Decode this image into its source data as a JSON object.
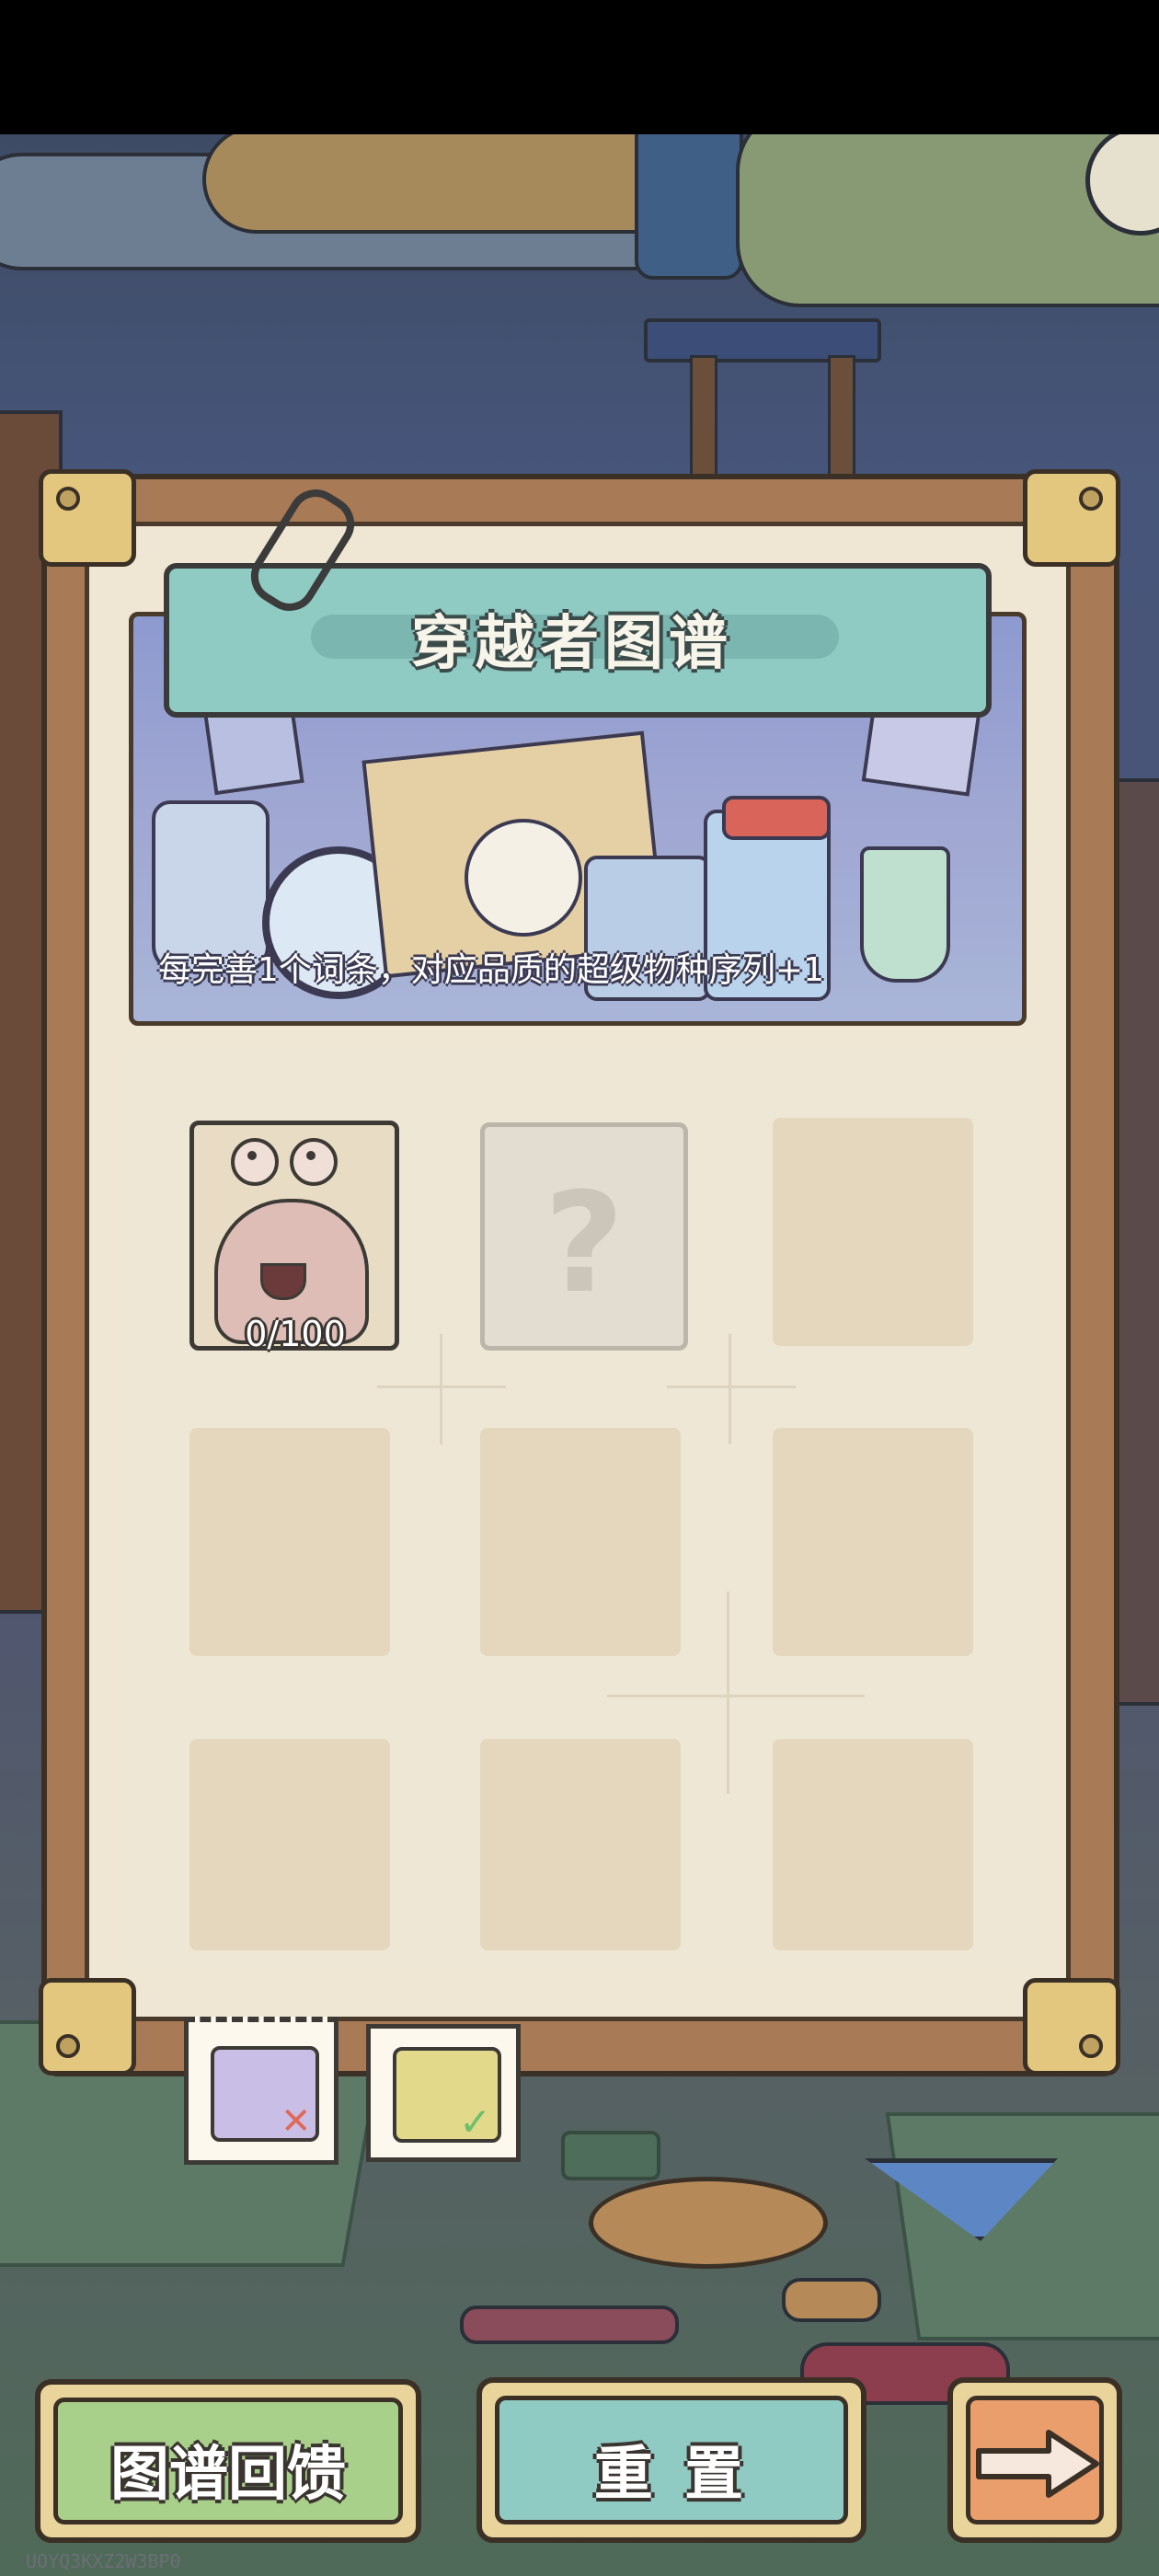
{
  "screen": {
    "title": "穿越者图谱"
  },
  "banner": {
    "description": "每完善1个词条，对应品质的超级物种序列+1"
  },
  "grid": {
    "cards": [
      {
        "state": "unlocked",
        "icon": "snail-creature-icon",
        "progress": "0/100"
      },
      {
        "state": "unknown",
        "icon": "question-mark-icon"
      }
    ],
    "empty_slots": 7
  },
  "filter_tabs": [
    {
      "icon": "card-incomplete-icon",
      "selected": true
    },
    {
      "icon": "card-complete-icon",
      "selected": false
    }
  ],
  "buttons": {
    "feedback": "图谱回馈",
    "reset": "重 置",
    "next_icon": "arrow-right-icon"
  },
  "watermark": "UOYQ3KXZ2W3BP0",
  "colors": {
    "panel_frame": "#a87a55",
    "panel_paper": "#efe6d3",
    "title_plaque": "#8fcac3",
    "feedback_button": "#a9d08a",
    "reset_button": "#8fcac3",
    "next_button": "#ea9e6c"
  }
}
